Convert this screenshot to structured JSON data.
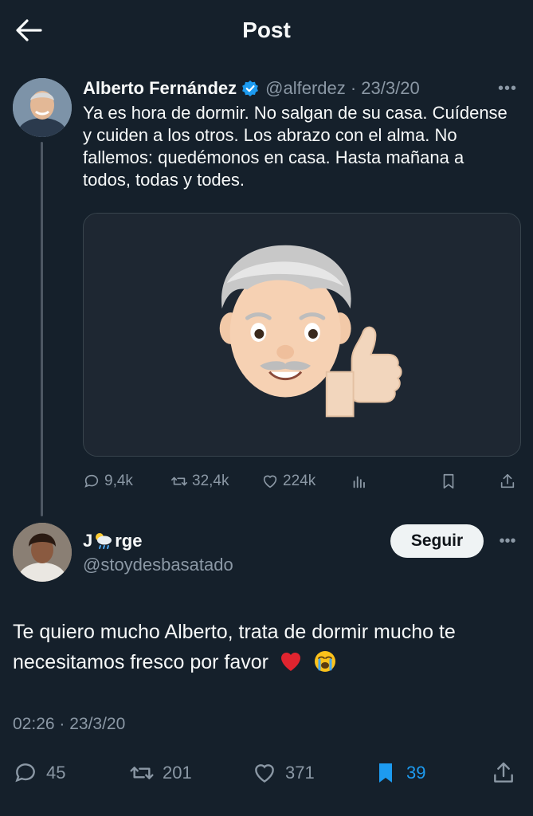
{
  "header": {
    "title": "Post"
  },
  "tweet": {
    "author_name": "Alberto Fernández",
    "handle": "@alferdez · 23/3/20",
    "text": "Ya es hora de dormir. No salgan de su casa. Cuídense y cuiden a los otros. Los abrazo con el alma. No fallemos: quedémonos en casa. Hasta mañana a todos, todas y todes.",
    "replies": "9,4k",
    "retweets": "32,4k",
    "likes": "224k"
  },
  "reply": {
    "name_start": "J",
    "name_end": "rge",
    "handle": "@stoydesbasatado",
    "follow_label": "Seguir",
    "text": "Te quiero mucho Alberto, trata de dormir mucho te necesitamos fresco por favor",
    "timestamp": "02:26 · 23/3/20",
    "replies": "45",
    "retweets": "201",
    "likes": "371",
    "bookmarks": "39"
  },
  "colors": {
    "background": "#15202b",
    "accent": "#1d9bf0",
    "muted": "#8b98a5"
  },
  "icons": [
    "back-arrow-icon",
    "verified-badge-icon",
    "more-icon",
    "reply-icon",
    "retweet-icon",
    "like-icon",
    "views-icon",
    "bookmark-icon",
    "share-icon",
    "heart-emoji",
    "crying-emoji",
    "cloud-rain-emoji"
  ]
}
